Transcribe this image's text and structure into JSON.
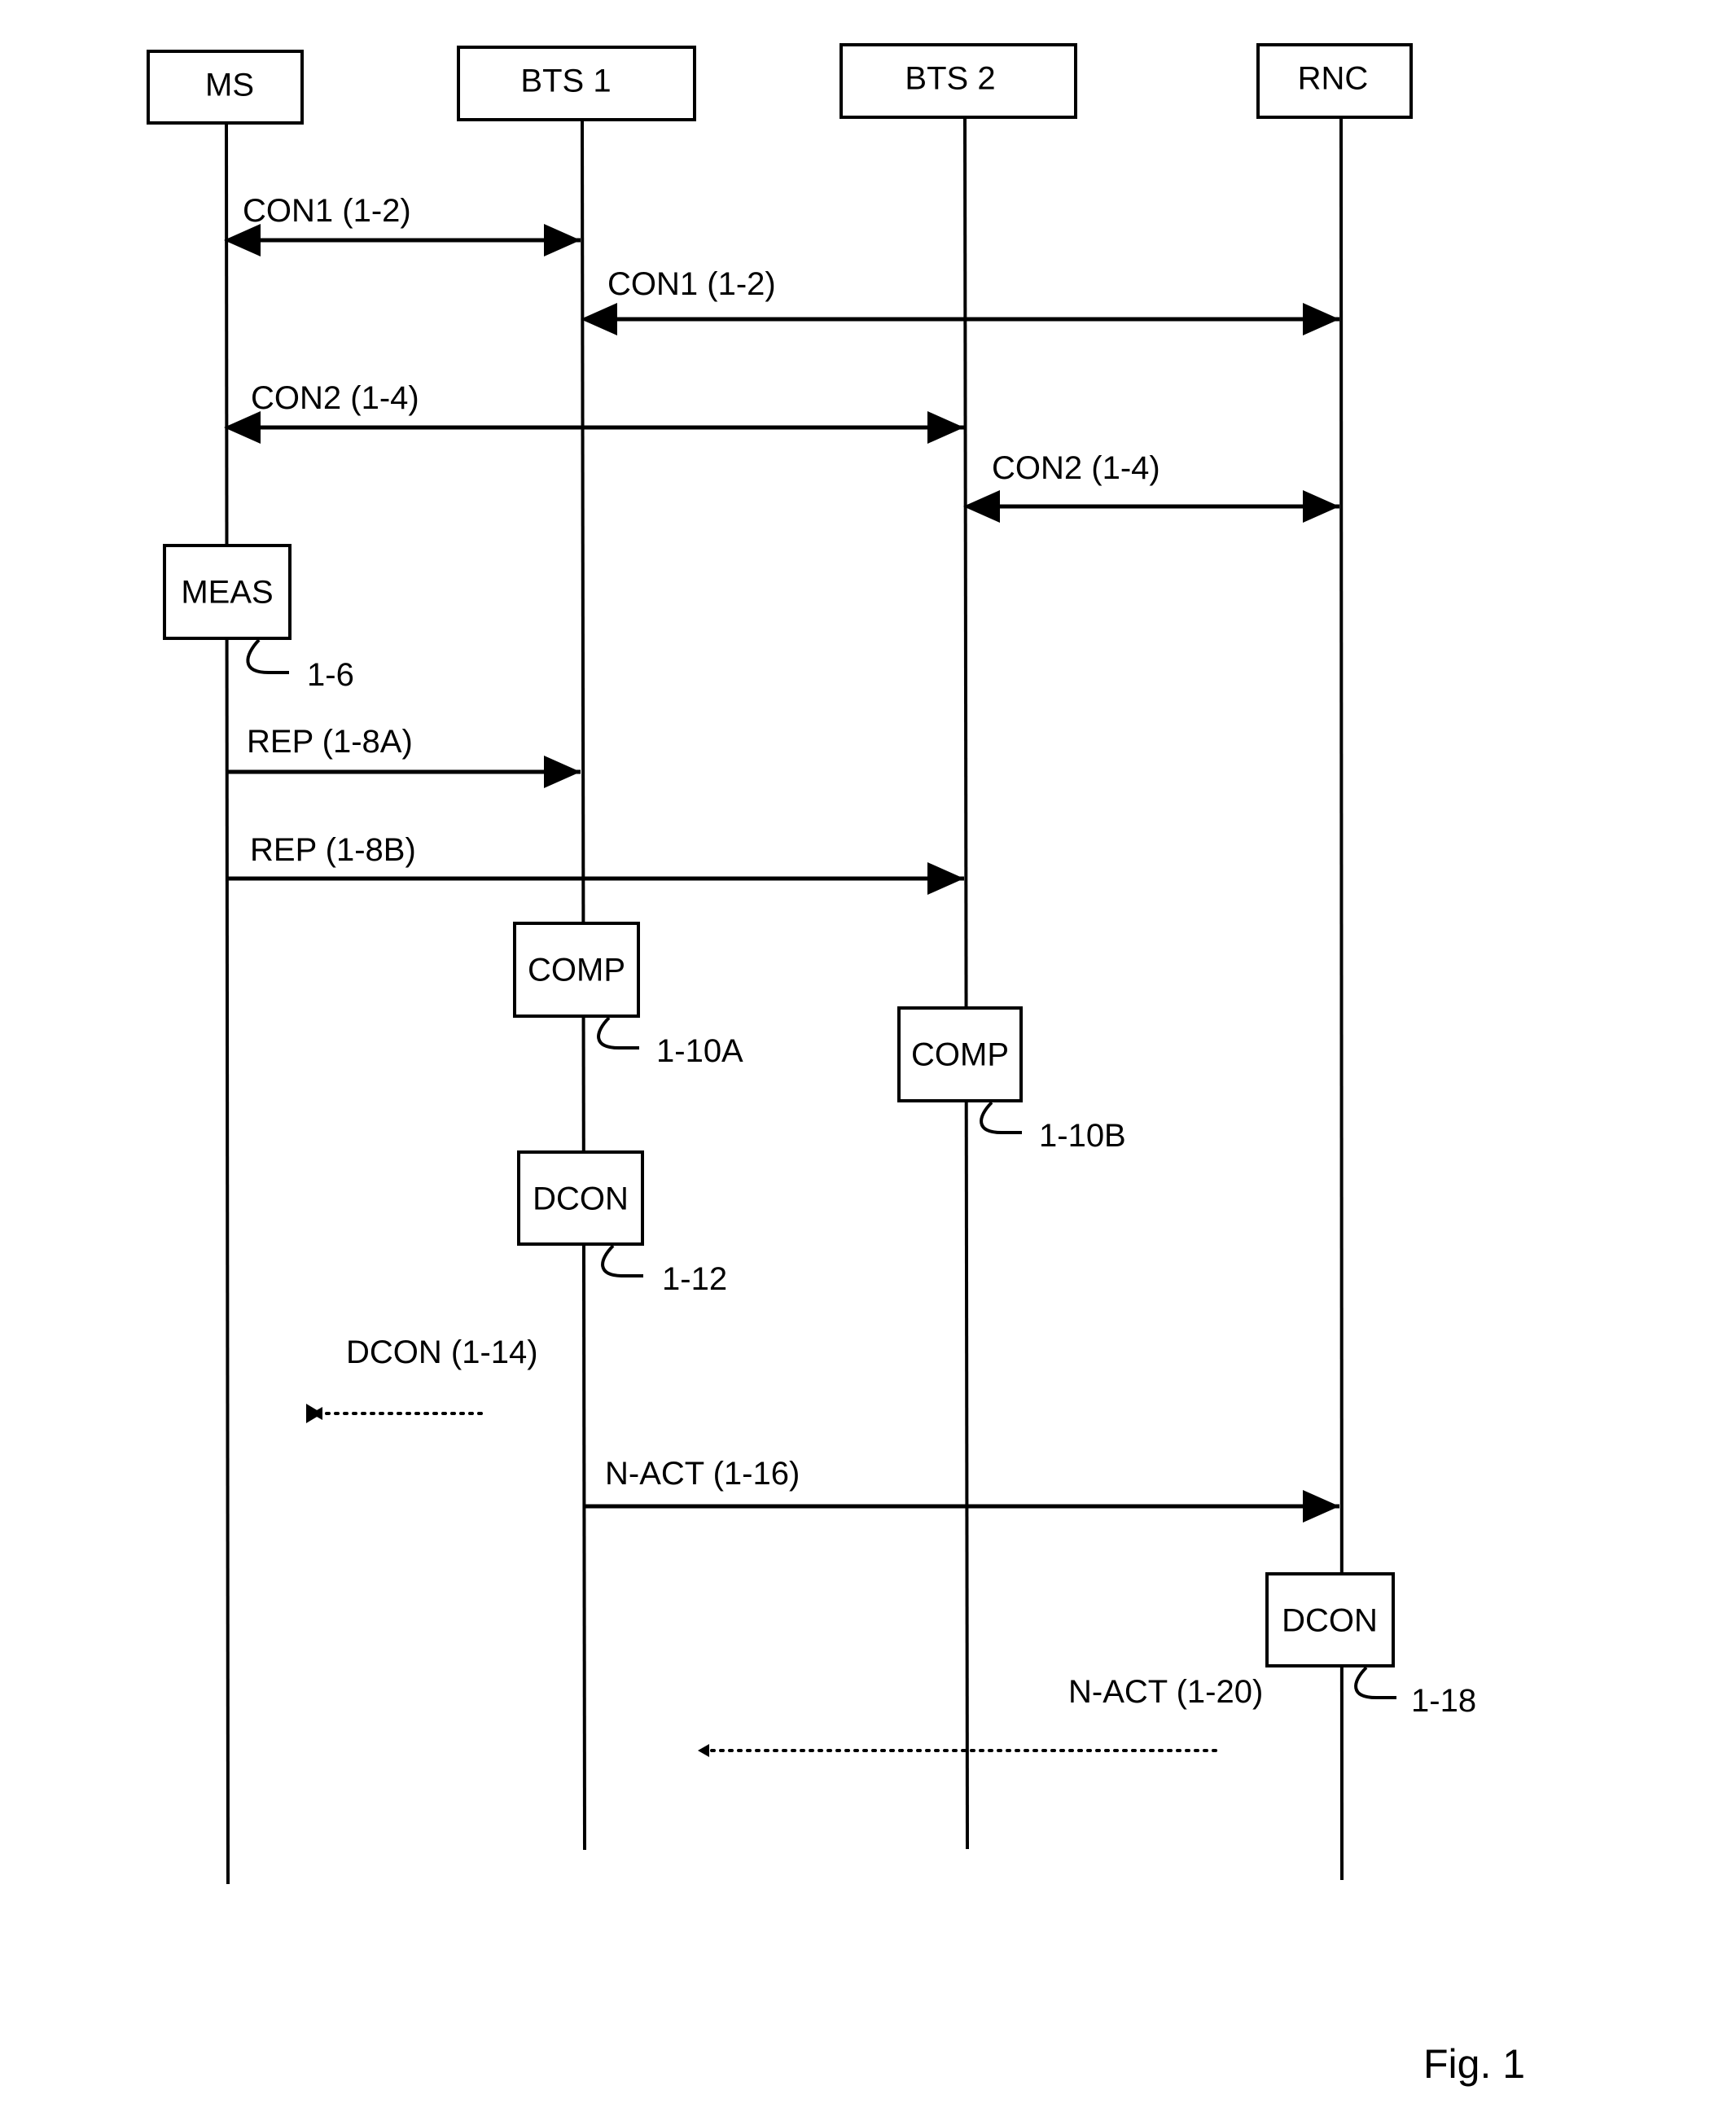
{
  "figure": {
    "caption": "Fig. 1",
    "entities": [
      {
        "id": "ms",
        "label": "MS"
      },
      {
        "id": "bts1",
        "label": "BTS 1"
      },
      {
        "id": "bts2",
        "label": "BTS 2"
      },
      {
        "id": "rnc",
        "label": "RNC"
      }
    ],
    "messages": [
      {
        "id": "con1-a",
        "label": "CON1 (1-2)",
        "from": "ms",
        "to": "bts1",
        "direction": "bidirectional",
        "style": "solid"
      },
      {
        "id": "con1-b",
        "label": "CON1 (1-2)",
        "from": "bts1",
        "to": "rnc",
        "direction": "bidirectional",
        "style": "solid"
      },
      {
        "id": "con2-a",
        "label": "CON2 (1-4)",
        "from": "ms",
        "to": "bts2",
        "direction": "bidirectional",
        "style": "solid"
      },
      {
        "id": "con2-b",
        "label": "CON2 (1-4)",
        "from": "bts2",
        "to": "rnc",
        "direction": "bidirectional",
        "style": "solid"
      },
      {
        "id": "rep-a",
        "label": "REP (1-8A)",
        "from": "ms",
        "to": "bts1",
        "direction": "forward",
        "style": "solid"
      },
      {
        "id": "rep-b",
        "label": "REP (1-8B)",
        "from": "ms",
        "to": "bts2",
        "direction": "forward",
        "style": "solid"
      },
      {
        "id": "dcon-14",
        "label": "DCON (1-14)",
        "from": "bts1",
        "to": "ms",
        "direction": "backward",
        "style": "dotted"
      },
      {
        "id": "nact-16",
        "label": "N-ACT (1-16)",
        "from": "bts1",
        "to": "rnc",
        "direction": "forward",
        "style": "solid"
      },
      {
        "id": "nact-20",
        "label": "N-ACT (1-20)",
        "from": "rnc",
        "to": "bts1",
        "direction": "backward",
        "style": "dotted"
      }
    ],
    "processes": [
      {
        "id": "meas",
        "label": "MEAS",
        "ref": "1-6",
        "on": "ms"
      },
      {
        "id": "comp-a",
        "label": "COMP",
        "ref": "1-10A",
        "on": "bts1"
      },
      {
        "id": "comp-b",
        "label": "COMP",
        "ref": "1-10B",
        "on": "bts2"
      },
      {
        "id": "dcon-12",
        "label": "DCON",
        "ref": "1-12",
        "on": "bts1"
      },
      {
        "id": "dcon-18",
        "label": "DCON",
        "ref": "1-18",
        "on": "rnc"
      }
    ]
  }
}
